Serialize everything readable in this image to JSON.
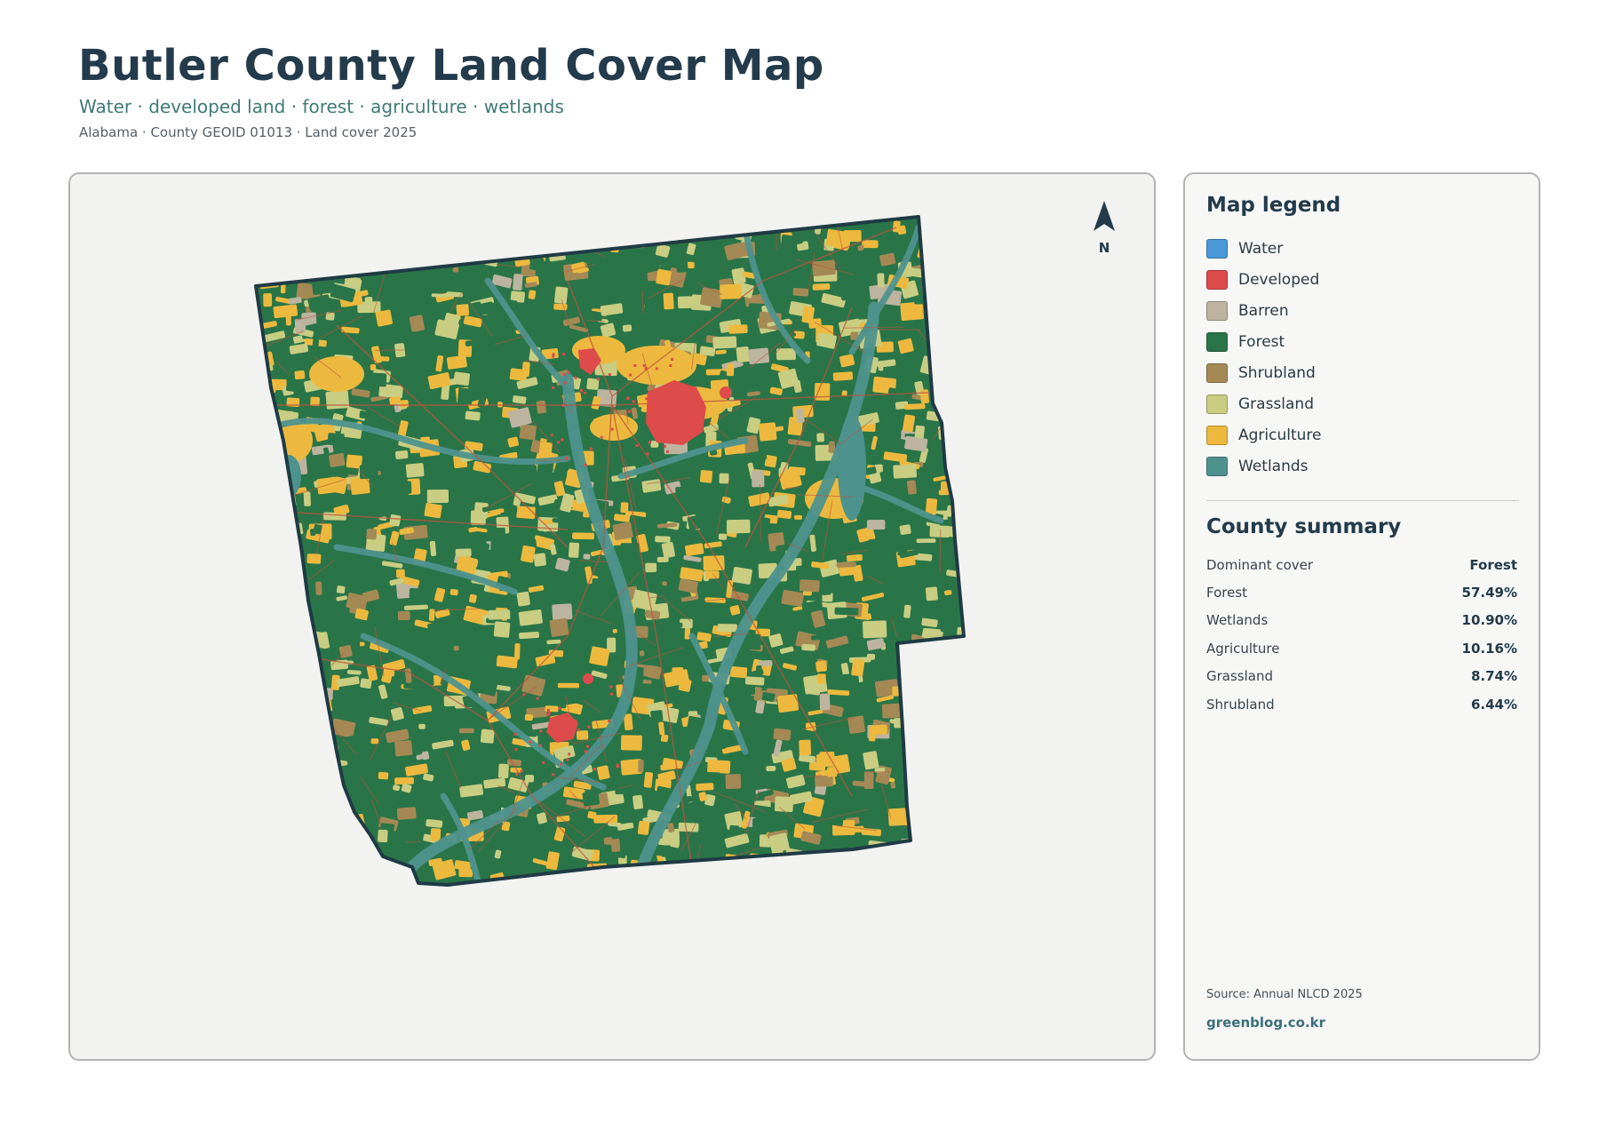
{
  "header": {
    "title": "Butler County Land Cover Map",
    "subtitle": "Water · developed land · forest · agriculture · wetlands",
    "meta": "Alabama · County GEOID 01013 · Land cover 2025"
  },
  "map": {
    "north_label": "N",
    "colors": {
      "water": "#4a98d8",
      "developed": "#de4b4b",
      "barren": "#bcb49f",
      "forest": "#2a7548",
      "shrubland": "#a48955",
      "grassland": "#c8cd82",
      "agriculture": "#ecb93e",
      "wetlands": "#4e928e",
      "roads": "#c0533d",
      "outline": "#1f3b44",
      "background": "#f2f2f1"
    }
  },
  "legend": {
    "title": "Map legend",
    "items": [
      {
        "label": "Water",
        "color": "#4a98d8"
      },
      {
        "label": "Developed",
        "color": "#de4b4b"
      },
      {
        "label": "Barren",
        "color": "#bcb49f"
      },
      {
        "label": "Forest",
        "color": "#2a7548"
      },
      {
        "label": "Shrubland",
        "color": "#a48955"
      },
      {
        "label": "Grassland",
        "color": "#c8cd82"
      },
      {
        "label": "Agriculture",
        "color": "#ecb93e"
      },
      {
        "label": "Wetlands",
        "color": "#4e928e"
      }
    ]
  },
  "summary": {
    "title": "County summary",
    "rows": [
      {
        "label": "Dominant cover",
        "value": "Forest"
      },
      {
        "label": "Forest",
        "value": "57.49%"
      },
      {
        "label": "Wetlands",
        "value": "10.90%"
      },
      {
        "label": "Agriculture",
        "value": "10.16%"
      },
      {
        "label": "Grassland",
        "value": "8.74%"
      },
      {
        "label": "Shrubland",
        "value": "6.44%"
      }
    ]
  },
  "footer": {
    "source": "Source: Annual NLCD 2025",
    "site": "greenblog.co.kr"
  }
}
